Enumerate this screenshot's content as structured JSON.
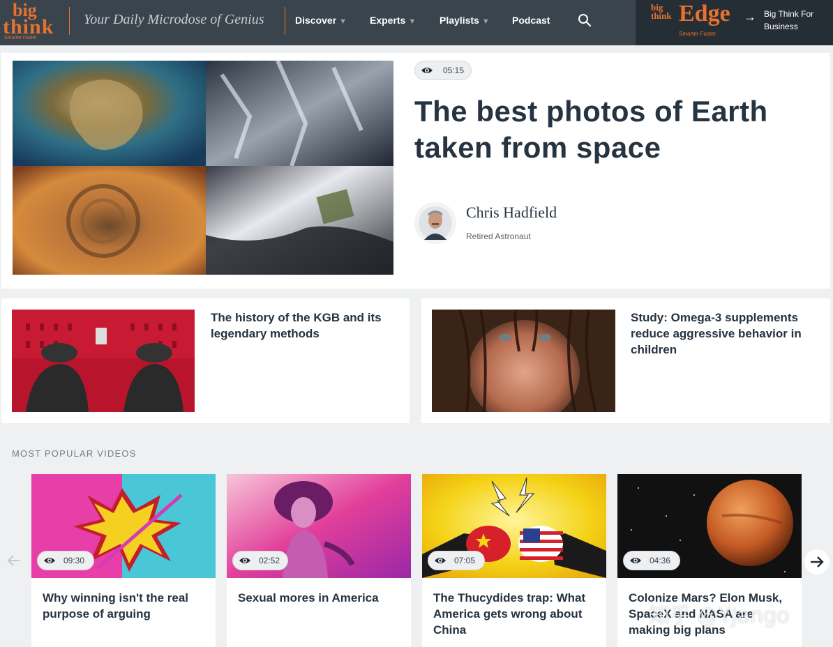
{
  "brand": {
    "logo_top": "big",
    "logo_bottom": "think",
    "logo_sub": "Smarter Faster",
    "tagline": "Your Daily Microdose of Genius"
  },
  "nav": {
    "items": [
      {
        "label": "Discover",
        "has_caret": true
      },
      {
        "label": "Experts",
        "has_caret": true
      },
      {
        "label": "Playlists",
        "has_caret": true
      },
      {
        "label": "Podcast",
        "has_caret": false
      }
    ],
    "search_icon": "search-icon",
    "caret": "▼"
  },
  "edge": {
    "logo_small": "big think",
    "logo_word": "Edge",
    "logo_sub": "Smarter Faster",
    "cta": "Big Think For Business",
    "cta_icon": "arrow-right-icon"
  },
  "hero": {
    "duration": "05:15",
    "title": "The best photos of Earth taken from space",
    "author_name": "Chris Hadfield",
    "author_role": "Retired Astronaut"
  },
  "articles": [
    {
      "title": "The history of the KGB and its legendary methods"
    },
    {
      "title": "Study: Omega-3 supplements reduce aggressive behavior in children"
    }
  ],
  "popular": {
    "label": "MOST POPULAR VIDEOS",
    "videos": [
      {
        "duration": "09:30",
        "title": "Why winning isn't the real purpose of arguing"
      },
      {
        "duration": "02:52",
        "title": "Sexual mores in America"
      },
      {
        "duration": "07:05",
        "title": "The Thucydides trap: What America gets wrong about China"
      },
      {
        "duration": "04:36",
        "title": "Colonize Mars? Elon Musk, SpaceX and NASA are making big plans"
      }
    ]
  },
  "watermark": "知乎 @YJango",
  "colors": {
    "nav_bg": "#3a444d",
    "edge_bg": "#262e35",
    "accent": "#e8722d",
    "title_text": "#263340"
  }
}
